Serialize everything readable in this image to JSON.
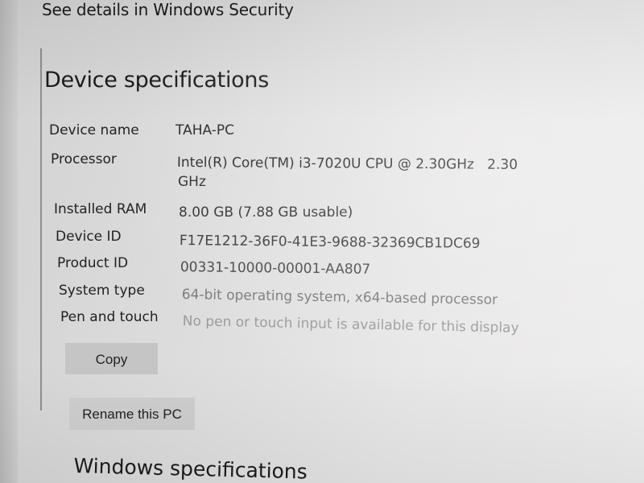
{
  "header": {
    "security_link": "See details in Windows Security"
  },
  "device_specs": {
    "title": "Device specifications",
    "rows": [
      {
        "label": "Device name",
        "value": "TAHA-PC",
        "value2": ""
      },
      {
        "label": "Processor",
        "value": "Intel(R) Core(TM) i3-7020U CPU @ 2.30GHz   2.30",
        "value2": "GHz"
      },
      {
        "label": "Installed RAM",
        "value": "8.00 GB (7.88 GB usable)",
        "value2": ""
      },
      {
        "label": "Device ID",
        "value": "F17E1212-36F0-41E3-9688-32369CB1DC69",
        "value2": ""
      },
      {
        "label": "Product ID",
        "value": "00331-10000-00001-AA807",
        "value2": ""
      },
      {
        "label": "System type",
        "value": "64-bit operating system, x64-based processor",
        "value2": ""
      },
      {
        "label": "Pen and touch",
        "value": "No pen or touch input is available for this display",
        "value2": ""
      }
    ],
    "copy_button": "Copy",
    "rename_button": "Rename this PC"
  },
  "windows_specs": {
    "title": "Windows specifications"
  },
  "colors": {
    "background": "#e4e3e3",
    "text": "#1b1b1b",
    "button": "#c6c5c5"
  }
}
